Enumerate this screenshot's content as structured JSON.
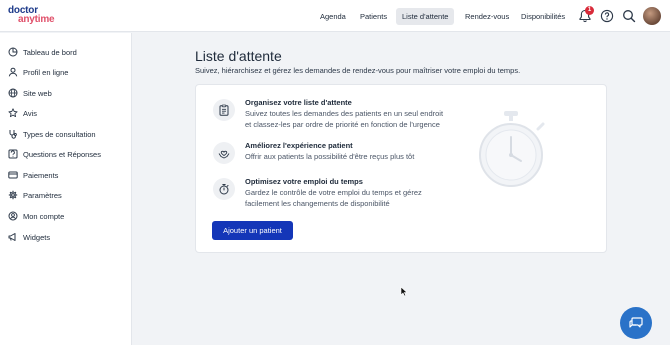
{
  "app": {
    "logo_line1": "doctor",
    "logo_line2": "anytime"
  },
  "topnav": [
    {
      "label": "Agenda"
    },
    {
      "label": "Patients"
    },
    {
      "label": "Liste d'attente"
    },
    {
      "label": "Rendez-vous"
    },
    {
      "label": "Disponibilités"
    }
  ],
  "notifications": {
    "count": "1"
  },
  "sidebar": {
    "items": [
      {
        "label": "Tableau de bord",
        "icon": "chart-pie-icon"
      },
      {
        "label": "Profil en ligne",
        "icon": "user-icon"
      },
      {
        "label": "Site web",
        "icon": "globe-icon"
      },
      {
        "label": "Avis",
        "icon": "star-icon"
      },
      {
        "label": "Types de consultation",
        "icon": "stethoscope-icon"
      },
      {
        "label": "Questions et Réponses",
        "icon": "question-chat-icon"
      },
      {
        "label": "Paiements",
        "icon": "credit-card-icon"
      },
      {
        "label": "Paramètres",
        "icon": "gear-icon"
      },
      {
        "label": "Mon compte",
        "icon": "account-circle-icon"
      },
      {
        "label": "Widgets",
        "icon": "megaphone-icon"
      }
    ]
  },
  "main": {
    "title": "Liste d'attente",
    "subtitle": "Suivez, hiérarchisez et gérez les demandes de rendez-vous pour maîtriser votre emploi du temps.",
    "features": [
      {
        "title": "Organisez votre liste d'attente",
        "desc_line1": "Suivez toutes les demandes des patients en un seul endroit",
        "desc_line2": "et classez-les par ordre de priorité en fonction de l'urgence",
        "icon": "clipboard-list-icon"
      },
      {
        "title": "Améliorez l'expérience patient",
        "desc_line1": "Offrir aux patients la possibilité d'être reçus plus tôt",
        "icon": "hands-heart-icon"
      },
      {
        "title": "Optimisez votre emploi du temps",
        "desc_line1": "Gardez le contrôle de votre emploi du temps et gérez",
        "desc_line2": "facilement les changements de disponibilité",
        "icon": "stopwatch-icon"
      }
    ],
    "add_button_label": "Ajouter un patient"
  },
  "colors": {
    "primary": "#1436b8",
    "brand_blue": "#1d3a8a",
    "brand_pink": "#e0506a",
    "chat_fab": "#2a72c8",
    "badge": "#d92b3a"
  }
}
